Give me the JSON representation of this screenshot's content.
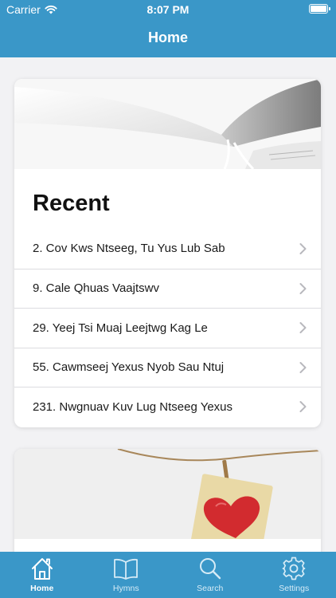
{
  "status": {
    "carrier": "Carrier",
    "time": "8:07 PM"
  },
  "nav": {
    "title": "Home"
  },
  "recent": {
    "title": "Recent",
    "items": [
      {
        "label": "2. Cov Kws Ntseeg, Tu Yus Lub Sab"
      },
      {
        "label": "9. Cale Qhuas Vaajtswv"
      },
      {
        "label": "29. Yeej Tsi Muaj Leejtwg Kag Le"
      },
      {
        "label": "55. Cawmseej Yexus Nyob Sau Ntuj"
      },
      {
        "label": "231. Nwgnuav Kuv Lug Ntseeg Yexus"
      }
    ]
  },
  "tabs": [
    {
      "label": "Home",
      "icon": "home-icon",
      "active": true
    },
    {
      "label": "Hymns",
      "icon": "book-icon",
      "active": false
    },
    {
      "label": "Search",
      "icon": "search-icon",
      "active": false
    },
    {
      "label": "Settings",
      "icon": "gear-icon",
      "active": false
    }
  ],
  "colors": {
    "accent": "#3a97c8",
    "background": "#f2f2f4",
    "heart": "#d22b2f"
  }
}
